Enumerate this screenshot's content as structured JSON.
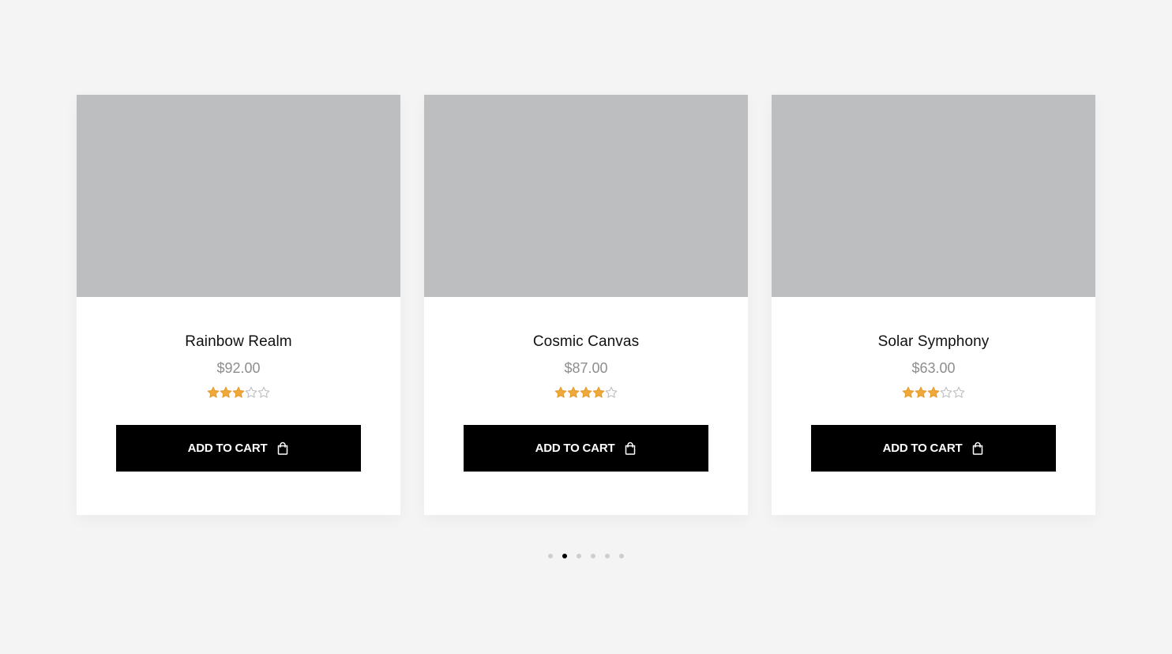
{
  "products": [
    {
      "title": "Rainbow Realm",
      "price": "$92.00",
      "rating": 3,
      "rating_max": 5,
      "button_label": "ADD TO CART",
      "button_icon": "shopping-bag-icon"
    },
    {
      "title": "Cosmic Canvas",
      "price": "$87.00",
      "rating": 4,
      "rating_max": 5,
      "button_label": "ADD TO CART",
      "button_icon": "shopping-bag-icon"
    },
    {
      "title": "Solar Symphony",
      "price": "$63.00",
      "rating": 3,
      "rating_max": 5,
      "button_label": "ADD TO CART",
      "button_icon": "shopping-bag-icon"
    }
  ],
  "pagination": {
    "total": 6,
    "active_index": 1
  },
  "colors": {
    "background": "#f4f4f4",
    "card": "#ffffff",
    "image_placeholder": "#bdbebf",
    "star_filled": "#f0a83a",
    "star_empty": "#b9b9b9",
    "button": "#000000",
    "button_text": "#ffffff",
    "price_text": "#8d8d8d",
    "dot_active": "#000000",
    "dot_inactive": "#cfcfcf"
  }
}
